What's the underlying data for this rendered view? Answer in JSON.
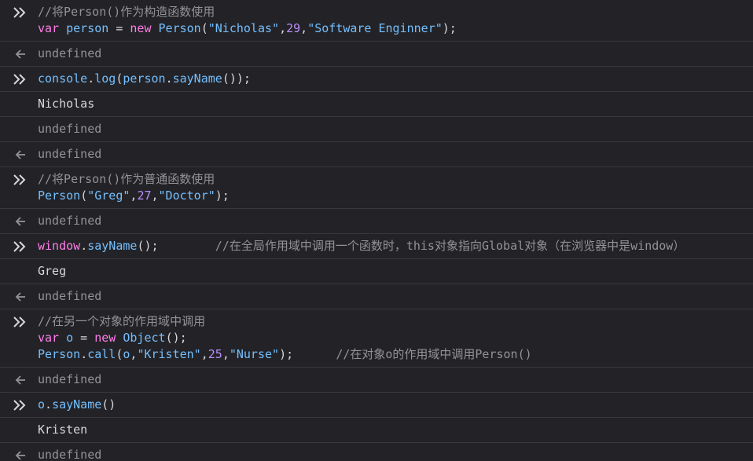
{
  "colors": {
    "background": "#232327",
    "separator": "#38383d",
    "comment": "#939395",
    "keyword": "#ff7de9",
    "identifier": "#75bfff",
    "string": "#86de74",
    "number": "#b98eff",
    "text": "#d7d7db"
  },
  "entries": [
    {
      "kind": "input",
      "icon": "input-chevron-icon",
      "lines": [
        [
          {
            "t": "//将Person()作为构造函数使用",
            "c": "comment"
          }
        ],
        [
          {
            "t": "var",
            "c": "kw"
          },
          {
            "t": " ",
            "c": "plain"
          },
          {
            "t": "person",
            "c": "var"
          },
          {
            "t": " = ",
            "c": "plain"
          },
          {
            "t": "new",
            "c": "kw"
          },
          {
            "t": " ",
            "c": "plain"
          },
          {
            "t": "Person",
            "c": "var"
          },
          {
            "t": "(",
            "c": "plain"
          },
          {
            "t": "\"Nicholas\"",
            "c": "var"
          },
          {
            "t": ",",
            "c": "plain"
          },
          {
            "t": "29",
            "c": "num"
          },
          {
            "t": ",",
            "c": "plain"
          },
          {
            "t": "\"Software Enginner\"",
            "c": "var"
          },
          {
            "t": ");",
            "c": "plain"
          }
        ]
      ]
    },
    {
      "kind": "result",
      "icon": "return-arrow-icon",
      "lines": [
        [
          {
            "t": "undefined",
            "c": "undef"
          }
        ]
      ]
    },
    {
      "kind": "input",
      "icon": "input-chevron-icon",
      "lines": [
        [
          {
            "t": "console",
            "c": "var"
          },
          {
            "t": ".",
            "c": "plain"
          },
          {
            "t": "log",
            "c": "var"
          },
          {
            "t": "(",
            "c": "plain"
          },
          {
            "t": "person",
            "c": "var"
          },
          {
            "t": ".",
            "c": "plain"
          },
          {
            "t": "sayName",
            "c": "var"
          },
          {
            "t": "());",
            "c": "plain"
          }
        ]
      ]
    },
    {
      "kind": "output",
      "icon": "",
      "lines": [
        [
          {
            "t": "Nicholas",
            "c": "out"
          }
        ]
      ]
    },
    {
      "kind": "output",
      "icon": "",
      "lines": [
        [
          {
            "t": "undefined",
            "c": "undef"
          }
        ]
      ]
    },
    {
      "kind": "result",
      "icon": "return-arrow-icon",
      "lines": [
        [
          {
            "t": "undefined",
            "c": "undef"
          }
        ]
      ]
    },
    {
      "kind": "input",
      "icon": "input-chevron-icon",
      "lines": [
        [
          {
            "t": "//将Person()作为普通函数使用",
            "c": "comment"
          }
        ],
        [
          {
            "t": "Person",
            "c": "var"
          },
          {
            "t": "(",
            "c": "plain"
          },
          {
            "t": "\"Greg\"",
            "c": "var"
          },
          {
            "t": ",",
            "c": "plain"
          },
          {
            "t": "27",
            "c": "num"
          },
          {
            "t": ",",
            "c": "plain"
          },
          {
            "t": "\"Doctor\"",
            "c": "var"
          },
          {
            "t": ");",
            "c": "plain"
          }
        ]
      ]
    },
    {
      "kind": "result",
      "icon": "return-arrow-icon",
      "lines": [
        [
          {
            "t": "undefined",
            "c": "undef"
          }
        ]
      ]
    },
    {
      "kind": "input",
      "icon": "input-chevron-icon",
      "lines": [
        [
          {
            "t": "window",
            "c": "kw"
          },
          {
            "t": ".",
            "c": "plain"
          },
          {
            "t": "sayName",
            "c": "var"
          },
          {
            "t": "();",
            "c": "plain"
          },
          {
            "t": "        ",
            "c": "plain"
          },
          {
            "t": "//在全局作用域中调用一个函数时，this对象指向Global对象（在浏览器中是window）",
            "c": "comment"
          }
        ]
      ]
    },
    {
      "kind": "output",
      "icon": "",
      "lines": [
        [
          {
            "t": "Greg",
            "c": "out"
          }
        ]
      ]
    },
    {
      "kind": "result",
      "icon": "return-arrow-icon",
      "lines": [
        [
          {
            "t": "undefined",
            "c": "undef"
          }
        ]
      ]
    },
    {
      "kind": "input",
      "icon": "input-chevron-icon",
      "lines": [
        [
          {
            "t": "//在另一个对象的作用域中调用",
            "c": "comment"
          }
        ],
        [
          {
            "t": "var",
            "c": "kw"
          },
          {
            "t": " ",
            "c": "plain"
          },
          {
            "t": "o",
            "c": "var"
          },
          {
            "t": " = ",
            "c": "plain"
          },
          {
            "t": "new",
            "c": "kw"
          },
          {
            "t": " ",
            "c": "plain"
          },
          {
            "t": "Object",
            "c": "var"
          },
          {
            "t": "();",
            "c": "plain"
          }
        ],
        [
          {
            "t": "Person",
            "c": "var"
          },
          {
            "t": ".",
            "c": "plain"
          },
          {
            "t": "call",
            "c": "var"
          },
          {
            "t": "(",
            "c": "plain"
          },
          {
            "t": "o",
            "c": "var"
          },
          {
            "t": ",",
            "c": "plain"
          },
          {
            "t": "\"Kristen\"",
            "c": "var"
          },
          {
            "t": ",",
            "c": "plain"
          },
          {
            "t": "25",
            "c": "num"
          },
          {
            "t": ",",
            "c": "plain"
          },
          {
            "t": "\"Nurse\"",
            "c": "var"
          },
          {
            "t": ");",
            "c": "plain"
          },
          {
            "t": "      ",
            "c": "plain"
          },
          {
            "t": "//在对象o的作用域中调用Person()",
            "c": "comment"
          }
        ]
      ]
    },
    {
      "kind": "result",
      "icon": "return-arrow-icon",
      "lines": [
        [
          {
            "t": "undefined",
            "c": "undef"
          }
        ]
      ]
    },
    {
      "kind": "input",
      "icon": "input-chevron-icon",
      "lines": [
        [
          {
            "t": "o",
            "c": "var"
          },
          {
            "t": ".",
            "c": "plain"
          },
          {
            "t": "sayName",
            "c": "var"
          },
          {
            "t": "()",
            "c": "plain"
          }
        ]
      ]
    },
    {
      "kind": "output",
      "icon": "",
      "lines": [
        [
          {
            "t": "Kristen",
            "c": "out"
          }
        ]
      ]
    },
    {
      "kind": "result",
      "icon": "return-arrow-icon",
      "lines": [
        [
          {
            "t": "undefined",
            "c": "undef"
          }
        ]
      ]
    }
  ]
}
